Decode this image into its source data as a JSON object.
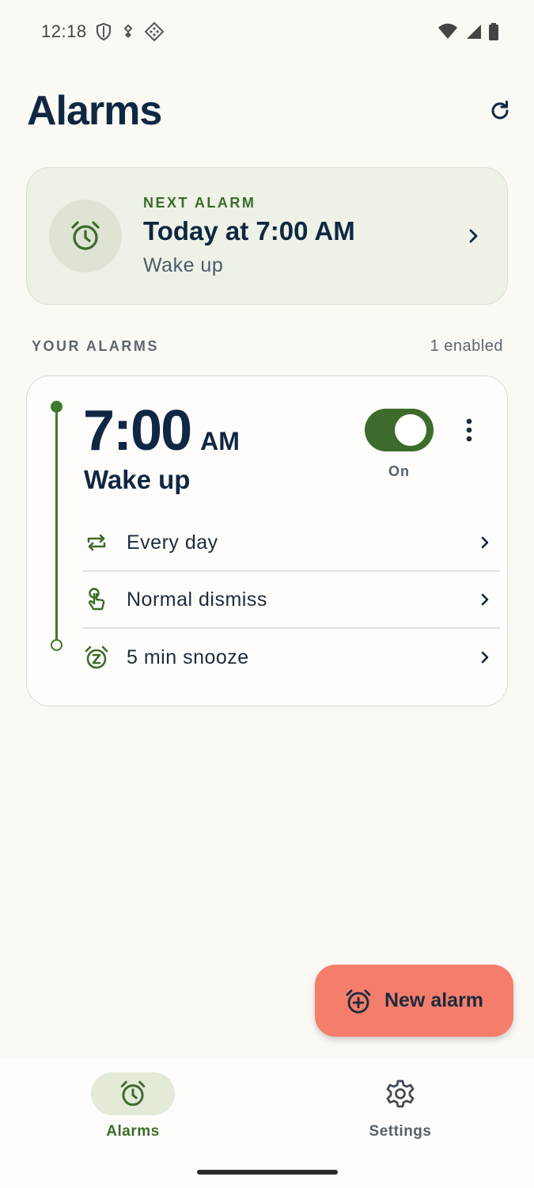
{
  "status_bar": {
    "time": "12:18"
  },
  "header": {
    "title": "Alarms"
  },
  "next_alarm": {
    "label": "NEXT ALARM",
    "time": "Today at 7:00 AM",
    "name": "Wake up"
  },
  "section": {
    "title": "YOUR ALARMS",
    "count": "1 enabled"
  },
  "alarm": {
    "time": "7:00",
    "ampm": "AM",
    "name": "Wake up",
    "toggle_label": "On",
    "enabled": true,
    "options": [
      {
        "label": "Every day",
        "icon": "repeat-icon"
      },
      {
        "label": "Normal dismiss",
        "icon": "tap-icon"
      },
      {
        "label": "5 min snooze",
        "icon": "snooze-icon"
      }
    ]
  },
  "fab": {
    "label": "New alarm"
  },
  "nav": {
    "items": [
      {
        "label": "Alarms",
        "icon": "alarm-clock-icon",
        "active": true
      },
      {
        "label": "Settings",
        "icon": "gear-icon",
        "active": false
      }
    ]
  },
  "colors": {
    "accent_green": "#3d6b2b",
    "fab": "#f47e6b",
    "background": "#fbf9f4",
    "text_primary": "#0f2742"
  }
}
